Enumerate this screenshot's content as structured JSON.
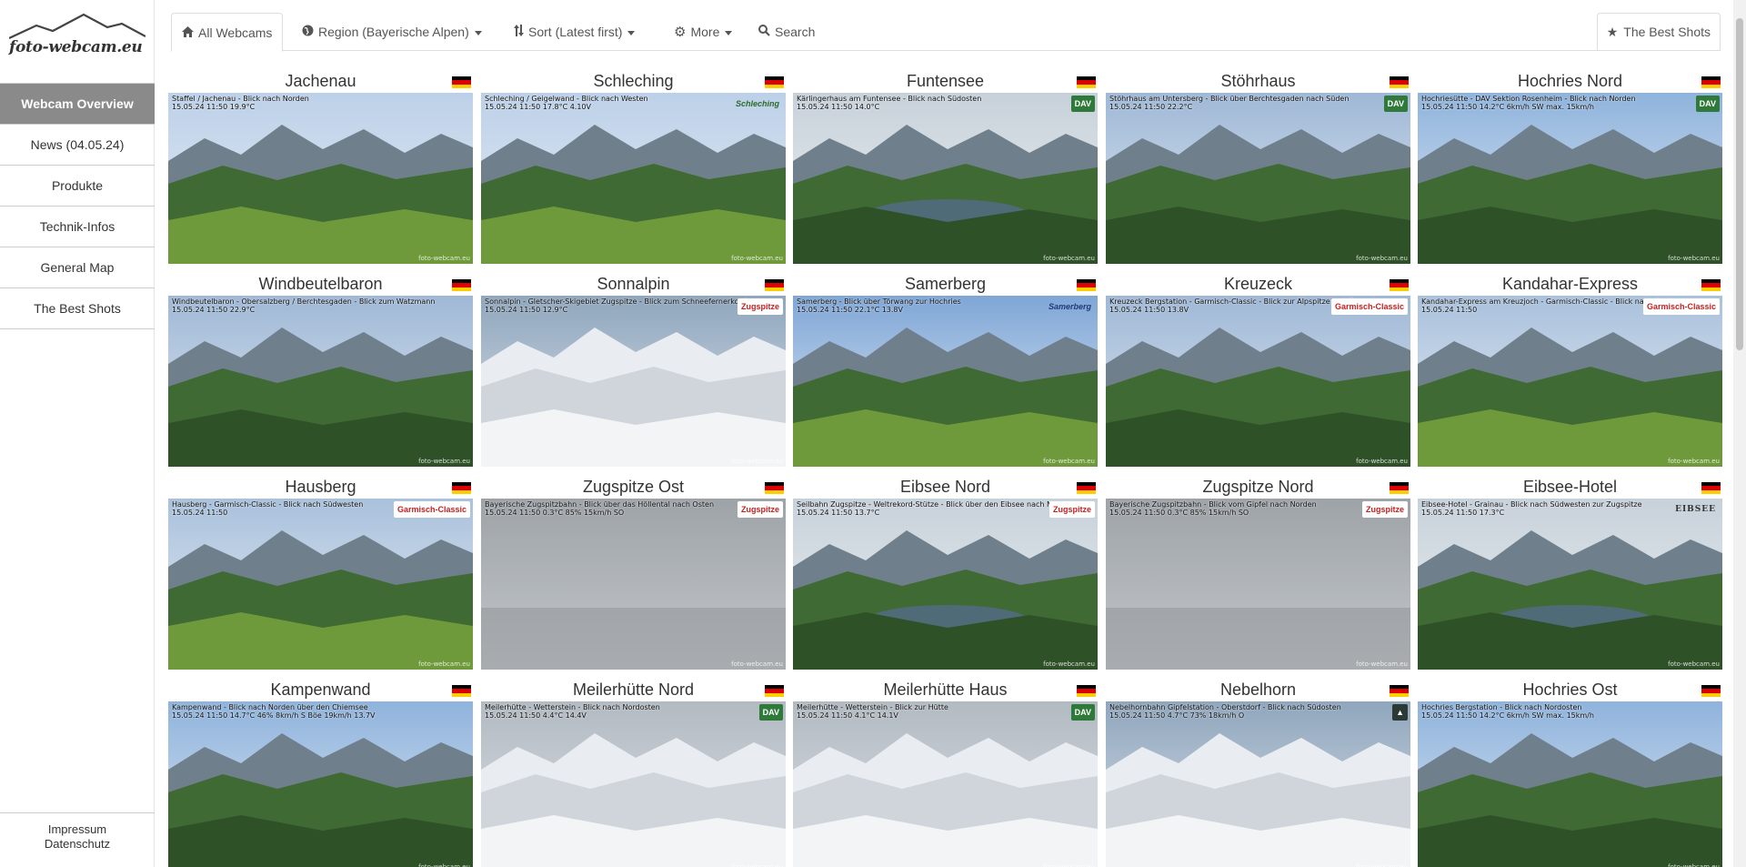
{
  "site": {
    "logo_text": "foto-webcam.eu"
  },
  "sidebar": {
    "items": [
      {
        "label": "Webcam Overview",
        "active": true
      },
      {
        "label": "News (04.05.24)"
      },
      {
        "label": "Produkte"
      },
      {
        "label": "Technik-Infos"
      },
      {
        "label": "General Map"
      },
      {
        "label": "The Best Shots"
      }
    ],
    "footer": {
      "impressum": "Impressum",
      "datenschutz": "Datenschutz"
    }
  },
  "toolbar": {
    "all_webcams": "All Webcams",
    "region": "Region (Bayerische Alpen)",
    "sort": "Sort (Latest first)",
    "more": "More",
    "search": "Search",
    "best_shots": "The Best Shots"
  },
  "icons": {
    "home": "home-icon",
    "globe": "globe-icon",
    "sort": "sort-icon",
    "gear": "gear-icon",
    "search": "search-icon",
    "star": "star-icon",
    "flag": "german-flag-icon"
  },
  "webcams": [
    {
      "name": "Jachenau",
      "caption1": "Staffel / Jachenau - Blick nach Norden",
      "caption2": "15.05.24 11:50   19.9°C",
      "logo": "",
      "scene": "valley"
    },
    {
      "name": "Schleching",
      "caption1": "Schleching / Geigelwand - Blick nach Westen",
      "caption2": "15.05.24 11:50   17.8°C  4.10V",
      "logo": "Schleching",
      "logo_style": "plain",
      "scene": "valley"
    },
    {
      "name": "Funtensee",
      "caption1": "Kärlingerhaus am Funtensee - Blick nach Südosten",
      "caption2": "15.05.24 11:50   14.0°C",
      "logo": "DAV",
      "logo_style": "dav",
      "scene": "lake"
    },
    {
      "name": "Stöhrhaus",
      "caption1": "Stöhrhaus am Untersberg - Blick über Berchtesgaden nach Süden",
      "caption2": "15.05.24 11:50   22.2°C",
      "logo": "DAV",
      "logo_style": "dav",
      "scene": "mountains"
    },
    {
      "name": "Hochries Nord",
      "caption1": "Hochriesütte - DAV Sektion Rosenheim - Blick nach Norden",
      "caption2": "15.05.24 11:50   14.2°C  6km/h SW   max. 15km/h",
      "logo": "DAV",
      "logo_style": "dav",
      "scene": "plain"
    },
    {
      "name": "Windbeutelbaron",
      "caption1": "Windbeutelbaron - Obersalzberg / Berchtesgaden - Blick zum Watzmann",
      "caption2": "15.05.24 11:50   22.9°C",
      "logo": "",
      "scene": "mountains"
    },
    {
      "name": "Sonnalpin",
      "caption1": "Sonnalpin - Gletscher-Skigebiet Zugspitze - Blick zum Schneefernerkopf",
      "caption2": "15.05.24 11:50   12.9°C",
      "logo": "Zugspitze",
      "logo_style": "red",
      "scene": "snow"
    },
    {
      "name": "Samerberg",
      "caption1": "Samerberg - Blick über Törwang zur Hochries",
      "caption2": "15.05.24 11:50   22.1°C  13.8V",
      "logo": "Samerberg",
      "logo_style": "navy",
      "scene": "meadow"
    },
    {
      "name": "Kreuzeck",
      "caption1": "Kreuzeck Bergstation - Garmisch-Classic - Blick zur Alpspitze und Zugspitze",
      "caption2": "15.05.24 11:50   13.8V",
      "logo": "Garmisch-Classic",
      "logo_style": "red",
      "scene": "mountains"
    },
    {
      "name": "Kandahar-Express",
      "caption1": "Kandahar-Express am Kreuzjoch - Garmisch-Classic - Blick nach Nordosten",
      "caption2": "15.05.24 11:50",
      "logo": "Garmisch-Classic",
      "logo_style": "red",
      "scene": "slope"
    },
    {
      "name": "Hausberg",
      "caption1": "Hausberg - Garmisch-Classic - Blick nach Südwesten",
      "caption2": "15.05.24 11:50",
      "logo": "Garmisch-Classic",
      "logo_style": "red",
      "scene": "slope"
    },
    {
      "name": "Zugspitze Ost",
      "caption1": "Bayerische Zugspitzbahn - Blick über das Höllental nach Osten",
      "caption2": "15.05.24 11:50   0.3°C   85%   15km/h SO",
      "logo": "Zugspitze",
      "logo_style": "red",
      "scene": "fog"
    },
    {
      "name": "Eibsee Nord",
      "caption1": "Seilbahn Zugspitze - Weltrekord-Stütze - Blick über den Eibsee nach Norden",
      "caption2": "15.05.24 11:50   13.7°C",
      "logo": "Zugspitze",
      "logo_style": "red",
      "scene": "lake"
    },
    {
      "name": "Zugspitze Nord",
      "caption1": "Bayerische Zugspitzbahn - Blick vom Gipfel nach Norden",
      "caption2": "15.05.24 11:50   0.3°C   85%   15km/h SO",
      "logo": "Zugspitze",
      "logo_style": "red",
      "scene": "fog"
    },
    {
      "name": "Eibsee-Hotel",
      "caption1": "Eibsee-Hotel - Grainau - Blick nach Südwesten zur Zugspitze",
      "caption2": "15.05.24 11:50   17.3°C",
      "logo": "EIBSEE",
      "logo_style": "serif",
      "scene": "lake"
    },
    {
      "name": "Kampenwand",
      "caption1": "Kampenwand - Blick nach Norden über den Chiemsee",
      "caption2": "15.05.24 11:50   14.7°C  46%   8km/h S   Böe 19km/h   13.7V",
      "logo": "",
      "scene": "plain"
    },
    {
      "name": "Meilerhütte Nord",
      "caption1": "Meilerhütte - Wetterstein - Blick nach Nordosten",
      "caption2": "15.05.24 11:50   4.4°C   14.4V",
      "logo": "DAV",
      "logo_style": "dav",
      "scene": "rock"
    },
    {
      "name": "Meilerhütte Haus",
      "caption1": "Meilerhütte - Wetterstein - Blick zur Hütte",
      "caption2": "15.05.24 11:50   4.1°C   14.1V",
      "logo": "DAV",
      "logo_style": "dav",
      "scene": "rock"
    },
    {
      "name": "Nebelhorn",
      "caption1": "Nebelhornbahn Gipfelstation - Oberstdorf - Blick nach Südosten",
      "caption2": "15.05.24 11:50   4.7°C   73%   18km/h O",
      "logo": "▲",
      "logo_style": "dark",
      "scene": "snow"
    },
    {
      "name": "Hochries Ost",
      "caption1": "Hochries Bergstation - Blick nach Nordosten",
      "caption2": "15.05.24 11:50   14.2°C  6km/h SW   max. 15km/h",
      "logo": "",
      "scene": "plain"
    }
  ],
  "watermark": "foto-webcam.eu"
}
